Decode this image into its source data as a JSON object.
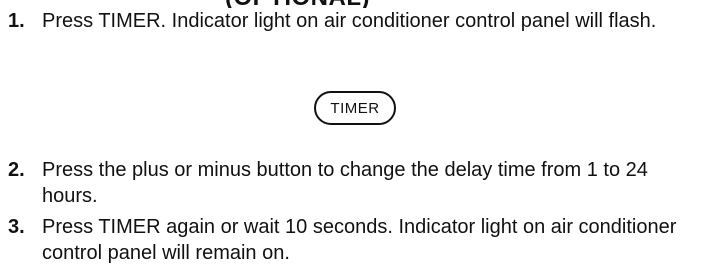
{
  "header": {
    "partial_text": "(OPTIONAL)"
  },
  "steps": [
    {
      "number": "1.",
      "text": "Press TIMER. Indicator light on air conditioner control panel will flash."
    },
    {
      "number": "2.",
      "text": "Press the plus or minus button to change the delay time from 1 to 24 hours."
    },
    {
      "number": "3.",
      "text": "Press TIMER again or wait 10 seconds. Indicator light on air conditioner control panel will remain on."
    }
  ],
  "timer_button": {
    "label": "TIMER"
  }
}
